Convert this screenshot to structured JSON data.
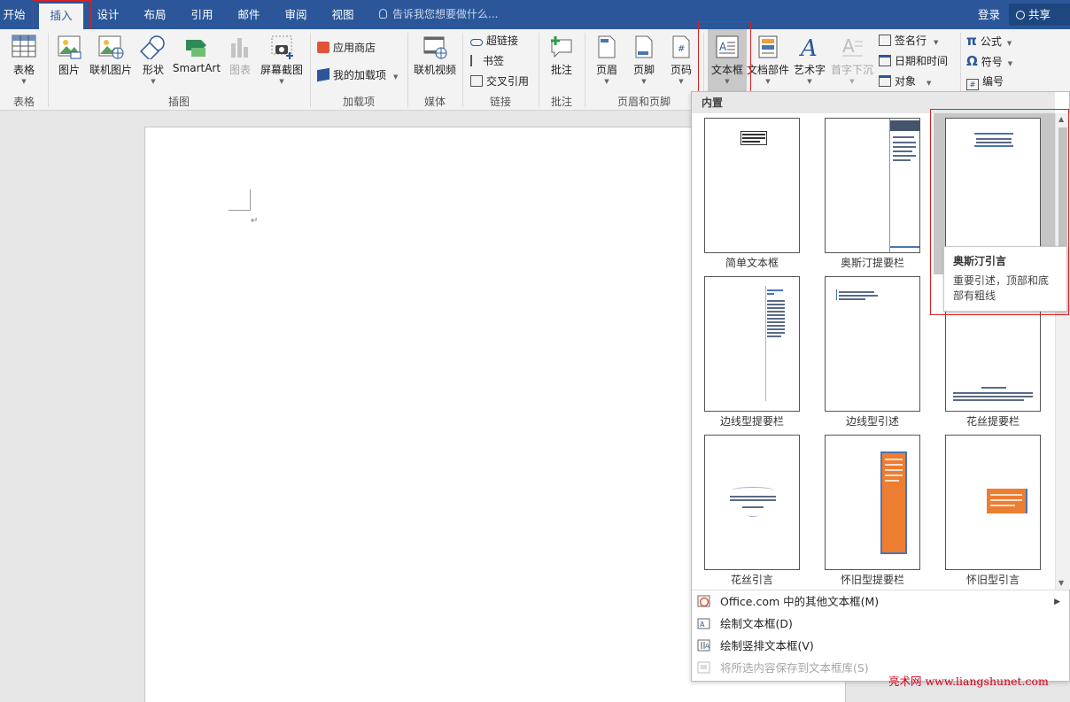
{
  "tabs": [
    {
      "label": "开始"
    },
    {
      "label": "插入"
    },
    {
      "label": "设计"
    },
    {
      "label": "布局"
    },
    {
      "label": "引用"
    },
    {
      "label": "邮件"
    },
    {
      "label": "审阅"
    },
    {
      "label": "视图"
    }
  ],
  "tell_me": "告诉我您想要做什么...",
  "account": {
    "login": "登录",
    "share": "共享"
  },
  "ribbon": {
    "table": {
      "label": "表格",
      "group": "表格"
    },
    "illustrations": {
      "picture": "图片",
      "online_picture": "联机图片",
      "shapes": "形状",
      "smartart": "SmartArt",
      "chart": "图表",
      "screenshot": "屏幕截图",
      "group": "插图"
    },
    "addins": {
      "store": "应用商店",
      "my_addins": "我的加载项",
      "group": "加载项"
    },
    "media": {
      "online_video": "联机视频",
      "group": "媒体"
    },
    "links": {
      "hyperlink": "超链接",
      "bookmark": "书签",
      "cross_ref": "交叉引用",
      "group": "链接"
    },
    "comments": {
      "comment": "批注",
      "group": "批注"
    },
    "header_footer": {
      "header": "页眉",
      "footer": "页脚",
      "page_number": "页码",
      "group": "页眉和页脚"
    },
    "text": {
      "textbox": "文本框",
      "quick_parts": "文档部件",
      "wordart": "艺术字",
      "dropcap": "首字下沉",
      "signature": "签名行",
      "datetime": "日期和时间",
      "object": "对象"
    },
    "symbols": {
      "equation": "公式",
      "symbol": "符号",
      "numbering": "编号"
    }
  },
  "gallery": {
    "section": "内置",
    "items": [
      {
        "label": "简单文本框"
      },
      {
        "label": "奥斯汀提要栏"
      },
      {
        "label": "奥斯汀引言"
      },
      {
        "label": "边线型提要栏"
      },
      {
        "label": "边线型引述"
      },
      {
        "label": "花丝提要栏"
      },
      {
        "label": "花丝引言"
      },
      {
        "label": "怀旧型提要栏"
      },
      {
        "label": "怀旧型引言"
      }
    ],
    "menu": [
      {
        "label": "Office.com 中的其他文本框(M)"
      },
      {
        "label": "绘制文本框(D)"
      },
      {
        "label": "绘制竖排文本框(V)"
      },
      {
        "label": "将所选内容保存到文本框库(S)"
      }
    ]
  },
  "tooltip": {
    "title": "奥斯汀引言",
    "description": "重要引述，顶部和底部有粗线"
  },
  "watermark": "亮术网 www.liangshunet.com",
  "colors": {
    "accent": "#2b579a",
    "highlight": "#e02020",
    "vintage_orange": "#ed7d31"
  }
}
